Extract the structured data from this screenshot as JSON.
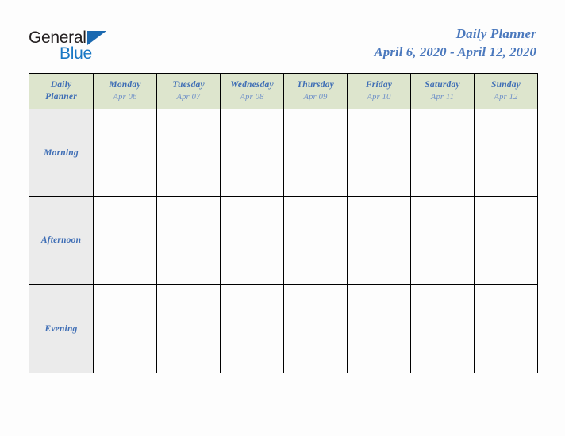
{
  "brand": {
    "name_part1": "General",
    "name_part2": "Blue",
    "triangle_icon": "triangle-icon",
    "accent_color": "#1877c4"
  },
  "header": {
    "title": "Daily Planner",
    "date_range": "April 6, 2020 - April 12, 2020",
    "title_color": "#4a78bd"
  },
  "table": {
    "corner_label_line1": "Daily",
    "corner_label_line2": "Planner",
    "header_bg": "#dde5cd",
    "row_label_bg": "#ebebeb",
    "border_color": "#000000",
    "columns": [
      {
        "day": "Monday",
        "date": "Apr 06"
      },
      {
        "day": "Tuesday",
        "date": "Apr 07"
      },
      {
        "day": "Wednesday",
        "date": "Apr 08"
      },
      {
        "day": "Thursday",
        "date": "Apr 09"
      },
      {
        "day": "Friday",
        "date": "Apr 10"
      },
      {
        "day": "Saturday",
        "date": "Apr 11"
      },
      {
        "day": "Sunday",
        "date": "Apr 12"
      }
    ],
    "rows": [
      {
        "label": "Morning",
        "cells": [
          "",
          "",
          "",
          "",
          "",
          "",
          ""
        ]
      },
      {
        "label": "Afternoon",
        "cells": [
          "",
          "",
          "",
          "",
          "",
          "",
          ""
        ]
      },
      {
        "label": "Evening",
        "cells": [
          "",
          "",
          "",
          "",
          "",
          "",
          ""
        ]
      }
    ]
  }
}
